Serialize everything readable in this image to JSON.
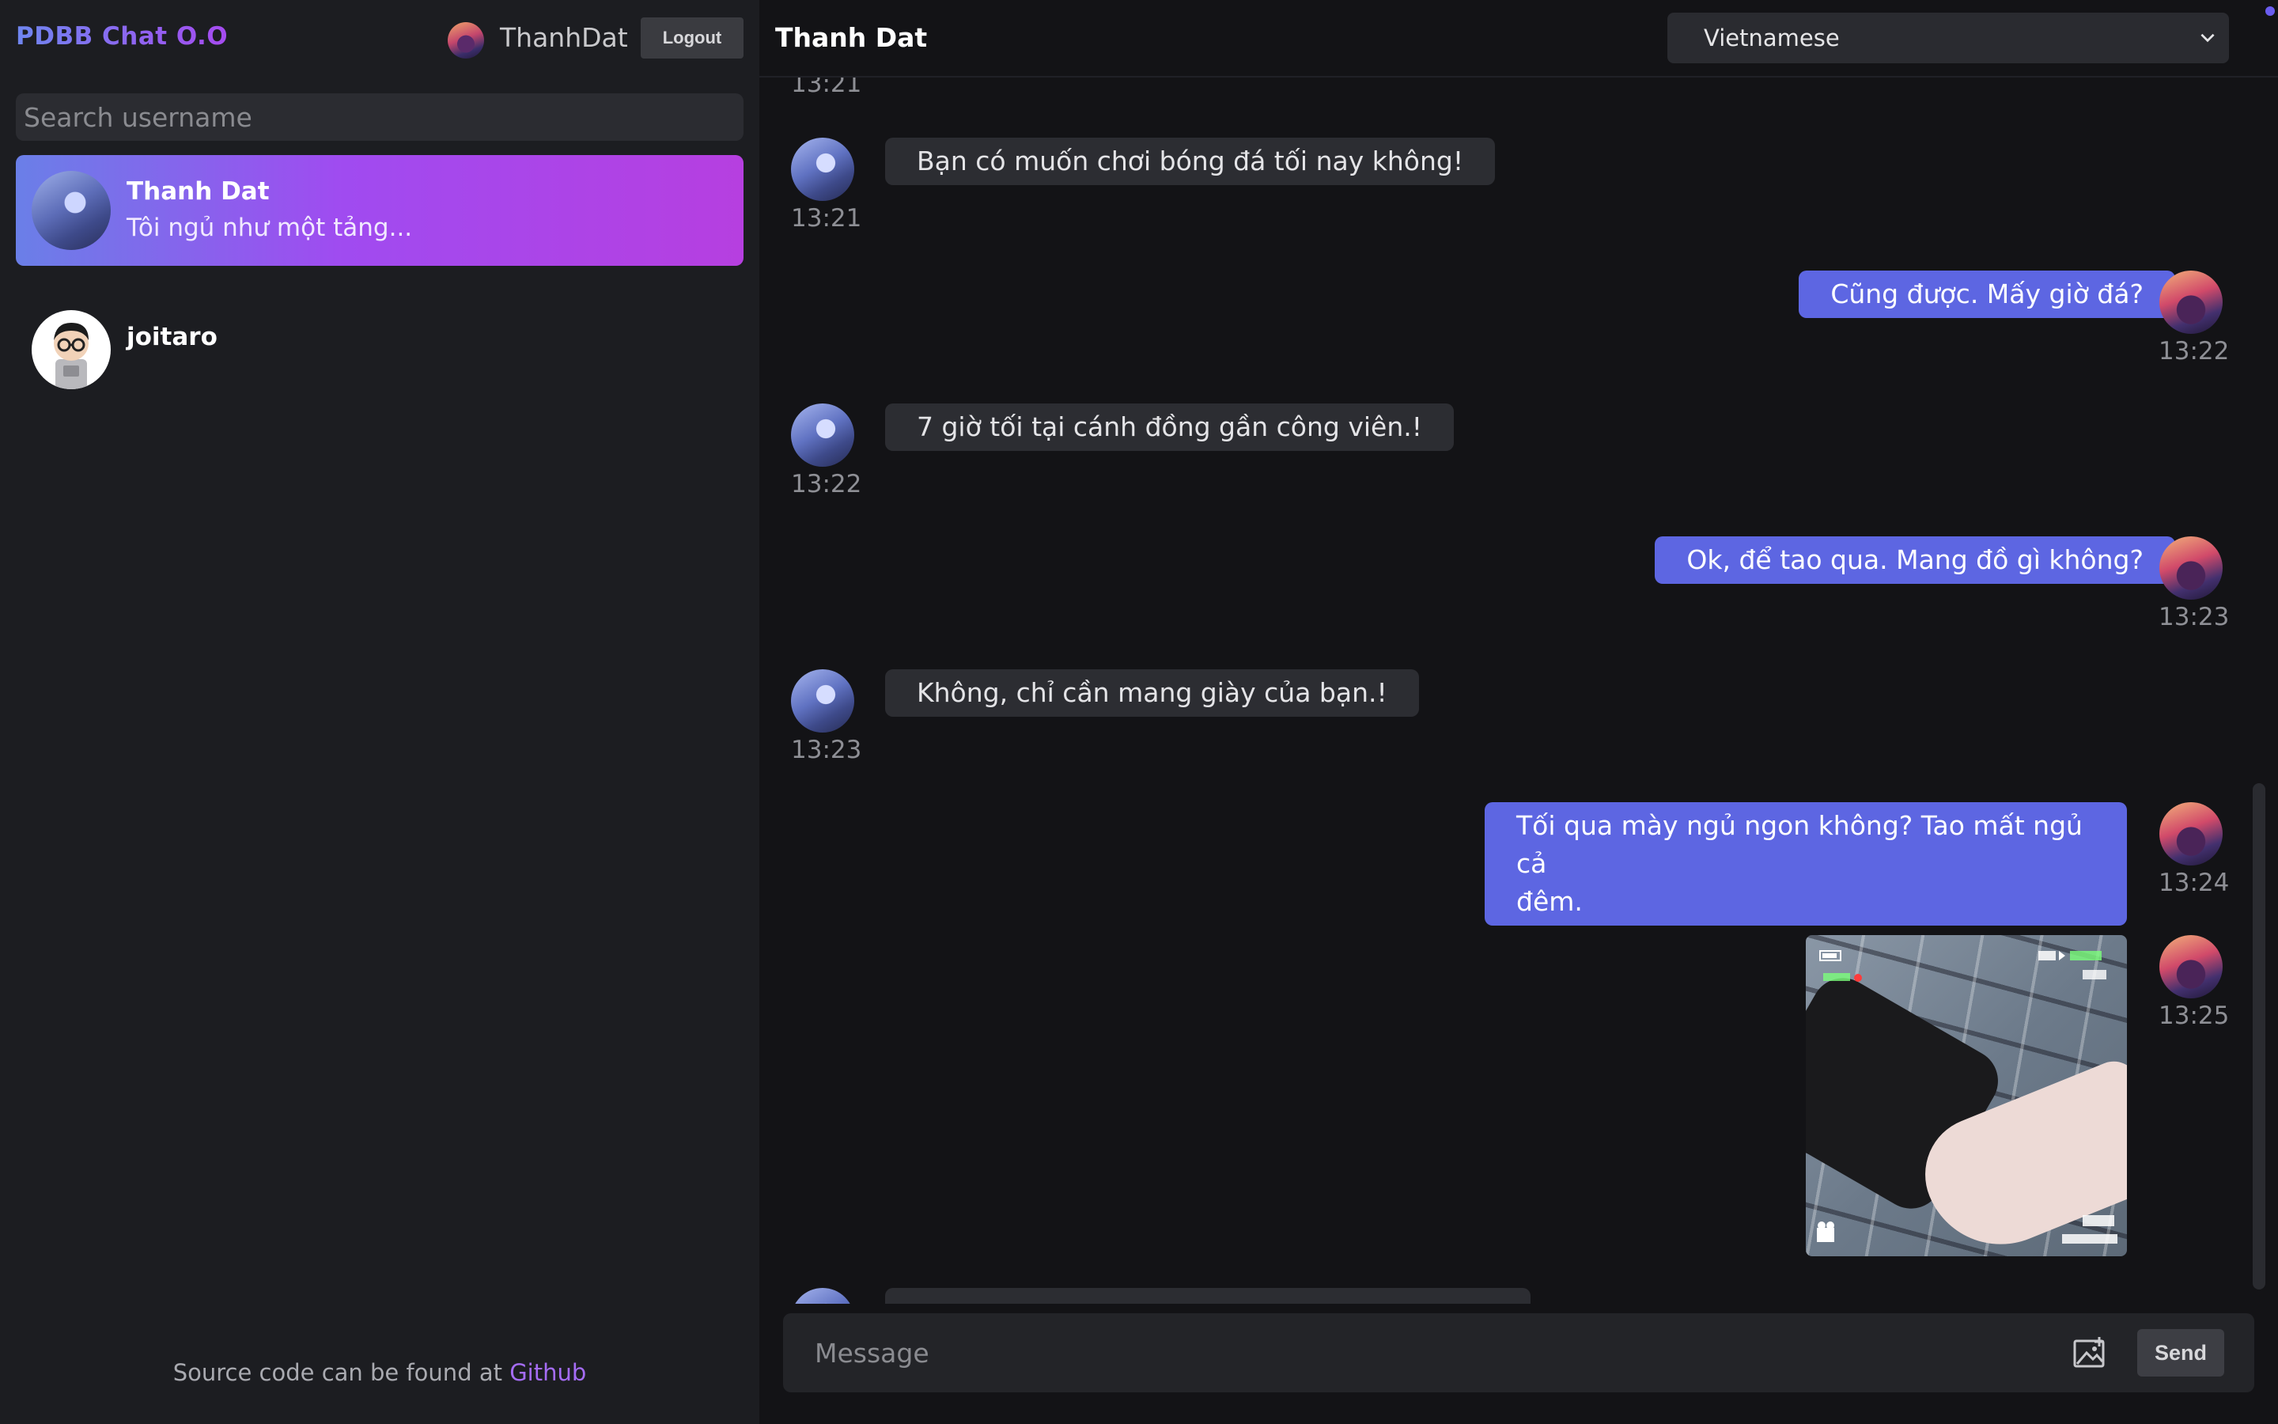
{
  "app": {
    "brand": "PDBB Chat O.O"
  },
  "user": {
    "name": "ThanhDat",
    "logout_label": "Logout"
  },
  "search": {
    "placeholder": "Search username"
  },
  "contacts": [
    {
      "name": "Thanh Dat",
      "preview": "Tôi ngủ như một tảng...",
      "active": true
    },
    {
      "name": "joitaro",
      "preview": "",
      "active": false
    }
  ],
  "footer": {
    "text": "Source code can be found at ",
    "link_label": "Github"
  },
  "chat": {
    "title": "Thanh Dat",
    "language": "Vietnamese",
    "messages": [
      {
        "direction": "in",
        "text": "",
        "time": "13:21"
      },
      {
        "direction": "in",
        "text": "Bạn có muốn chơi bóng đá tối nay không!",
        "time": "13:21"
      },
      {
        "direction": "out",
        "text": "Cũng được. Mấy giờ đá?",
        "time": "13:22"
      },
      {
        "direction": "in",
        "text": "7 giờ tối tại cánh đồng gần công viên.!",
        "time": "13:22"
      },
      {
        "direction": "out",
        "text": "Ok, để tao qua. Mang đồ gì không?",
        "time": "13:23"
      },
      {
        "direction": "in",
        "text": "Không, chỉ cần mang giày của bạn.!",
        "time": "13:23"
      },
      {
        "direction": "out",
        "text_line1": "Tối qua mày ngủ ngon không? Tao mất ngủ cả",
        "text_line2": "đêm.",
        "time": "13:24"
      },
      {
        "direction": "out",
        "type": "image",
        "time": "13:25"
      }
    ]
  },
  "composer": {
    "placeholder": "Message",
    "send_label": "Send"
  },
  "colors": {
    "accent": "#5d66e2",
    "brand_start": "#6f86f0",
    "brand_end": "#a64bf0",
    "link": "#a56cf5"
  },
  "icons": {
    "image_upload": "image-icon",
    "dropdown": "chevron-down-icon"
  }
}
